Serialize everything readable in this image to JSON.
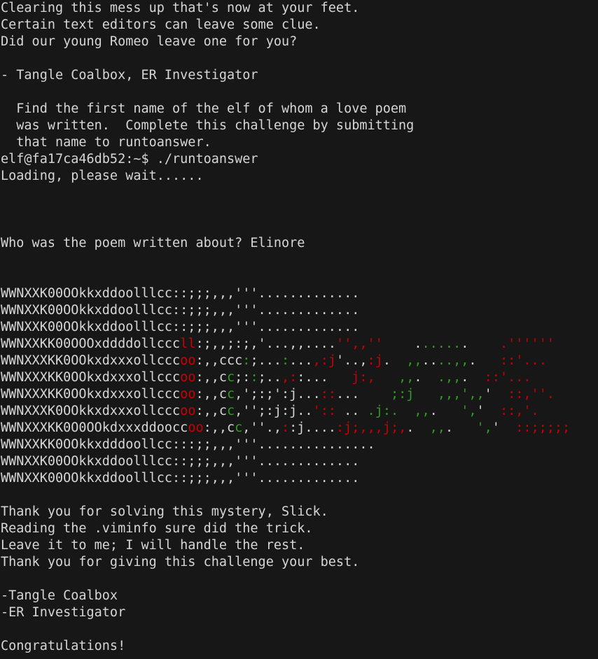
{
  "terminal": {
    "background_color": "#171717",
    "foreground_color": "#d6d6d6",
    "red_color": "#cc0000",
    "green_color": "#2f9e20",
    "prompt": "elf@fa17ca46db52:~$",
    "command": "./runtoanswer",
    "hostname": "fa17ca46db52",
    "user": "elf"
  },
  "intro": {
    "line1": "Clearing this mess up that's now at your feet.",
    "line2": "Certain text editors can leave some clue.",
    "line3": "Did our young Romeo leave one for you?",
    "blank1": "",
    "signature": "- Tangle Coalbox, ER Investigator",
    "blank2": "",
    "task1": "  Find the first name of the elf of whom a love poem",
    "task2": "  was written.  Complete this challenge by submitting",
    "task3": "  that name to runtoanswer."
  },
  "session": {
    "prompt_line": "elf@fa17ca46db52:~$ ./runtoanswer",
    "loading": "Loading, please wait......",
    "question": "Who was the poem written about? Elinore",
    "answer": "Elinore"
  },
  "ascii_art": {
    "description": "ascii-art-banner",
    "lines": [
      [
        {
          "t": "WWNXXK00OOkkxddoolllcc::;;;,,,'''.............",
          "c": "def"
        }
      ],
      [
        {
          "t": "WWNXXK00OOkkxddoolllcc::;;;,,,'''.............",
          "c": "def"
        }
      ],
      [
        {
          "t": "WWNXXK00OOkkxddoolllcc::;;;,,,'''.............",
          "c": "def"
        }
      ],
      [
        {
          "t": "WWNXXKK00OOOxddddollccc",
          "c": "def"
        },
        {
          "t": "ll",
          "c": "red"
        },
        {
          "t": ":;,,;:;,'...,,....",
          "c": "def"
        },
        {
          "t": "'',,''",
          "c": "red"
        },
        {
          "t": "    .",
          "c": "def"
        },
        {
          "t": ".....",
          "c": "grn"
        },
        {
          "t": ".    ",
          "c": "def"
        },
        {
          "t": ".''''''",
          "c": "red"
        }
      ],
      [
        {
          "t": "WWNXXXKK0OOkxdxxxollccc",
          "c": "def"
        },
        {
          "t": "oo",
          "c": "red"
        },
        {
          "t": ":,,ccc",
          "c": "def"
        },
        {
          "t": ":",
          "c": "grn"
        },
        {
          "t": ";...",
          "c": "def"
        },
        {
          "t": ":",
          "c": "grn"
        },
        {
          "t": "...",
          "c": "def"
        },
        {
          "t": ",:j",
          "c": "red"
        },
        {
          "t": "'..,",
          "c": "def"
        },
        {
          "t": ":j",
          "c": "red"
        },
        {
          "t": ".  ",
          "c": "def"
        },
        {
          "t": ",,",
          "c": "grn"
        },
        {
          "t": "..",
          "c": "def"
        },
        {
          "t": "..,,",
          "c": "grn"
        },
        {
          "t": ".   ",
          "c": "def"
        },
        {
          "t": "::",
          "c": "red"
        },
        {
          "t": "'...",
          "c": "red"
        }
      ],
      [
        {
          "t": "WWNXXXKK0OOkxdxxxollccc",
          "c": "def"
        },
        {
          "t": "oo",
          "c": "red"
        },
        {
          "t": ":,,c",
          "c": "def"
        },
        {
          "t": "c",
          "c": "grn"
        },
        {
          "t": ";:",
          "c": "def"
        },
        {
          "t": ":",
          "c": "grn"
        },
        {
          "t": ";..",
          "c": "def"
        },
        {
          "t": ",:",
          "c": "red"
        },
        {
          "t": ":",
          "c": "def"
        },
        {
          "t": "...   ",
          "c": "def"
        },
        {
          "t": "j:",
          "c": "red"
        },
        {
          "t": ",",
          "c": "red"
        },
        {
          "t": "   ",
          "c": "def"
        },
        {
          "t": ",,",
          "c": "grn"
        },
        {
          "t": ".  ",
          "c": "def"
        },
        {
          "t": ".,,",
          "c": "grn"
        },
        {
          "t": ".  ",
          "c": "def"
        },
        {
          "t": "::",
          "c": "red"
        },
        {
          "t": "'...",
          "c": "red"
        }
      ],
      [
        {
          "t": "WWNXXXKK0OOkxdxxxollccc",
          "c": "def"
        },
        {
          "t": "oo",
          "c": "red"
        },
        {
          "t": ":,,c",
          "c": "def"
        },
        {
          "t": "c",
          "c": "grn"
        },
        {
          "t": ",';:;",
          "c": "def"
        },
        {
          "t": "'",
          "c": "def"
        },
        {
          "t": ":",
          "c": "def"
        },
        {
          "t": "j...",
          "c": "def"
        },
        {
          "t": ":",
          "c": "red"
        },
        {
          "t": ":",
          "c": "red"
        },
        {
          "t": "...    ",
          "c": "def"
        },
        {
          "t": ";:",
          "c": "grn"
        },
        {
          "t": "j",
          "c": "grn"
        },
        {
          "t": "   ",
          "c": "def"
        },
        {
          "t": ",,,",
          "c": "grn"
        },
        {
          "t": "'",
          "c": "grn"
        },
        {
          "t": ",,",
          "c": "grn"
        },
        {
          "t": "'  ",
          "c": "def"
        },
        {
          "t": "::",
          "c": "red"
        },
        {
          "t": ",",
          "c": "red"
        },
        {
          "t": "''",
          "c": "red"
        },
        {
          "t": ".",
          "c": "red"
        }
      ],
      [
        {
          "t": "WWNXXXK0OOkkxdxxxollccc",
          "c": "def"
        },
        {
          "t": "oo",
          "c": "red"
        },
        {
          "t": ":,,c",
          "c": "def"
        },
        {
          "t": "c",
          "c": "grn"
        },
        {
          "t": ",'';:j:j",
          "c": "def"
        },
        {
          "t": "..",
          "c": "def"
        },
        {
          "t": "':",
          "c": "red"
        },
        {
          "t": ":",
          "c": "red"
        },
        {
          "t": " .. ",
          "c": "def"
        },
        {
          "t": ".j",
          "c": "grn"
        },
        {
          "t": ":",
          "c": "grn"
        },
        {
          "t": ".",
          "c": "grn"
        },
        {
          "t": "  ",
          "c": "def"
        },
        {
          "t": ",,",
          "c": "grn"
        },
        {
          "t": ".   ",
          "c": "def"
        },
        {
          "t": "'",
          "c": "grn"
        },
        {
          "t": ",",
          "c": "grn"
        },
        {
          "t": "'  ",
          "c": "def"
        },
        {
          "t": "::",
          "c": "red"
        },
        {
          "t": ",",
          "c": "red"
        },
        {
          "t": "'.",
          "c": "red"
        }
      ],
      [
        {
          "t": "WWNXXXKK0O0OOkdxxxddoocc",
          "c": "def"
        },
        {
          "t": "oo",
          "c": "red"
        },
        {
          "t": ":,,c",
          "c": "def"
        },
        {
          "t": "c",
          "c": "grn"
        },
        {
          "t": ",''.,",
          "c": "def"
        },
        {
          "t": ":",
          "c": "red"
        },
        {
          "t": ":",
          "c": "def"
        },
        {
          "t": "j....",
          "c": "def"
        },
        {
          "t": ":j;,,,j;",
          "c": "red"
        },
        {
          "t": ",",
          "c": "red"
        },
        {
          "t": ".  ",
          "c": "def"
        },
        {
          "t": ",,",
          "c": "grn"
        },
        {
          "t": ".   ",
          "c": "def"
        },
        {
          "t": "'",
          "c": "grn"
        },
        {
          "t": ",",
          "c": "grn"
        },
        {
          "t": "'  ",
          "c": "def"
        },
        {
          "t": "::",
          "c": "red"
        },
        {
          "t": ";;;;;",
          "c": "red"
        }
      ],
      [
        {
          "t": "WWNXXKK0OOkkxdddoollcc:::;;,,,'''...............",
          "c": "def"
        }
      ],
      [
        {
          "t": "WWNXXK00OOkkxddoolllcc::;;;,,,'''.............",
          "c": "def"
        }
      ],
      [
        {
          "t": "WWNXXK00OOkkxddoolllcc::;;;,,,'''.............",
          "c": "def"
        }
      ]
    ]
  },
  "outro": {
    "line1": "Thank you for solving this mystery, Slick.",
    "line2": "Reading the .viminfo sure did the trick.",
    "line3": "Leave it to me; I will handle the rest.",
    "line4": "Thank you for giving this challenge your best.",
    "blank": "",
    "sign1": "-Tangle Coalbox",
    "sign2": "-ER Investigator",
    "congrats": "Congratulations!"
  }
}
